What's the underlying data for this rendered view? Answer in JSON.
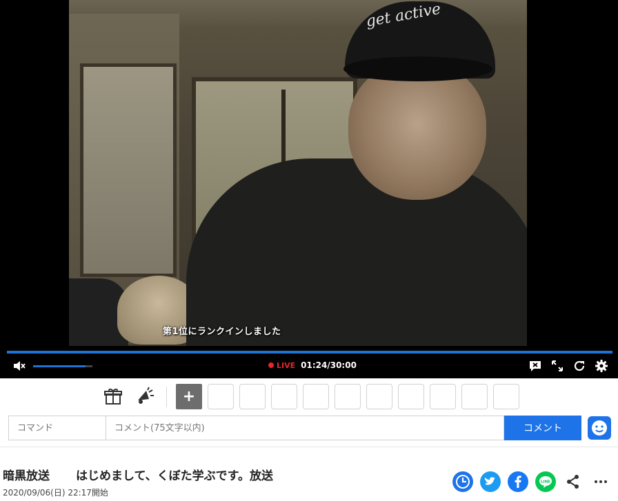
{
  "player": {
    "ticker_text": "第1位にランクインしました",
    "live_label": "LIVE",
    "elapsed": "01:24",
    "duration": "30:00",
    "time_display": "01:24/30:00",
    "volume_level": 0.88,
    "progress": 1.0,
    "accent_color": "#1e73d6",
    "live_color": "#e5262a",
    "cap_text": "get active"
  },
  "controls": {
    "left_icons": [
      "mute-icon"
    ],
    "right_icons": [
      "comment-toggle-icon",
      "fullscreen-icon",
      "reload-icon",
      "settings-icon"
    ]
  },
  "actions": {
    "gift_icon": "gift-icon",
    "cheer_icon": "megaphone-icon",
    "add_label": "+",
    "slot_count": 10
  },
  "comment_form": {
    "command_placeholder": "コマンド",
    "comment_placeholder": "コメント(75文字以内)",
    "submit_label": "コメント",
    "submit_color": "#1e73e8"
  },
  "info": {
    "channel": "暗黒放送",
    "title": "はじめまして、くぼた学ぶです。放送",
    "started": "2020/09/06(日) 22:17開始",
    "share_icons": [
      "clock-icon",
      "twitter-icon",
      "facebook-icon",
      "line-icon",
      "share-icon",
      "more-icon"
    ]
  }
}
